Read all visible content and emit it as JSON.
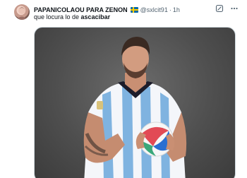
{
  "tweet": {
    "author_name": "PAPANICOLAOU PARA ZENON",
    "flag_icon": "sweden-flag-icon",
    "handle": "@sxlcit91",
    "separator": "·",
    "time": "1h",
    "text_before": "que locura lo de ",
    "text_bold": "ascacibar",
    "actions": {
      "grok_icon": "grok-icon",
      "more_icon": "more-icon"
    }
  }
}
